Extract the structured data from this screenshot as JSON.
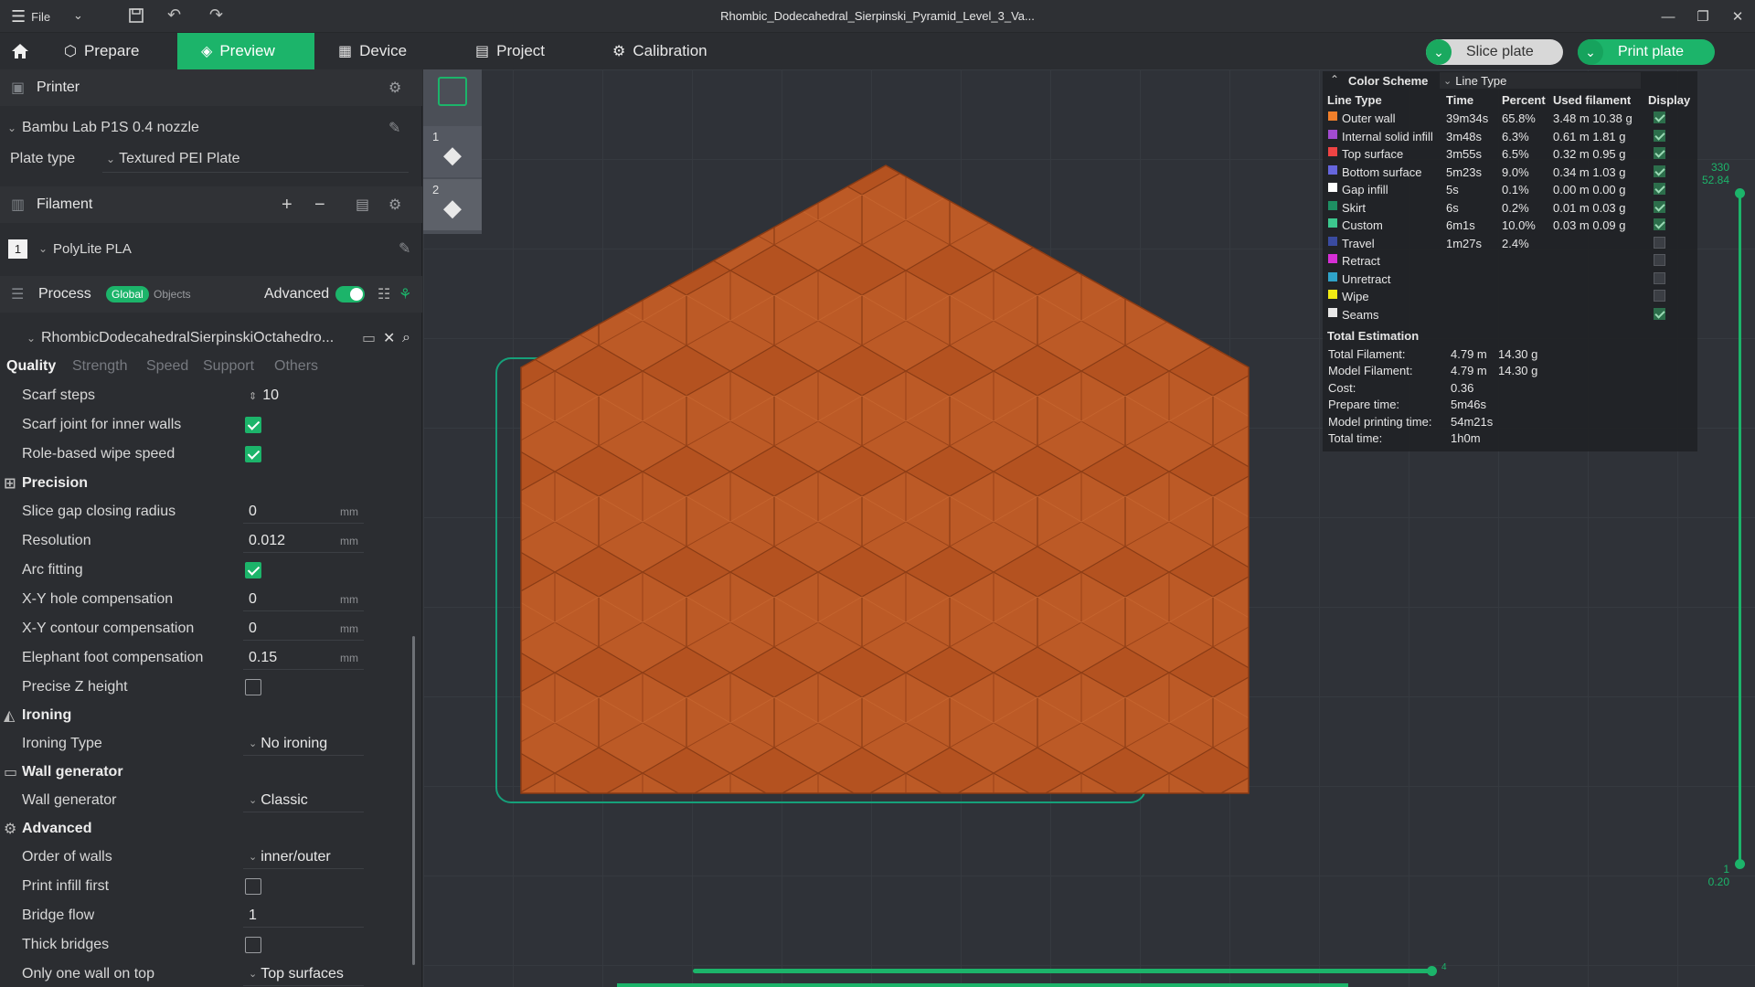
{
  "window": {
    "title": "Rhombic_Dodecahedral_Sierpinski_Pyramid_Level_3_Va...",
    "file_menu": "File"
  },
  "nav": {
    "tabs": [
      {
        "label": "Prepare"
      },
      {
        "label": "Preview"
      },
      {
        "label": "Device"
      },
      {
        "label": "Project"
      },
      {
        "label": "Calibration"
      }
    ],
    "slice_plate": "Slice plate",
    "print_plate": "Print plate"
  },
  "printer": {
    "section_label": "Printer",
    "name": "Bambu Lab P1S 0.4 nozzle",
    "plate_type_label": "Plate type",
    "plate_type_value": "Textured PEI Plate"
  },
  "filament": {
    "section_label": "Filament",
    "slot": "1",
    "name": "PolyLite PLA"
  },
  "process": {
    "section_label": "Process",
    "global": "Global",
    "objects": "Objects",
    "advanced_label": "Advanced",
    "object_name": "RhombicDodecahedralSierpinskiOctahedro...",
    "tabs": [
      "Quality",
      "Strength",
      "Speed",
      "Support",
      "Others"
    ]
  },
  "settings": {
    "scarf_steps": {
      "label": "Scarf steps",
      "value": "10"
    },
    "scarf_joint_inner": {
      "label": "Scarf joint for inner walls"
    },
    "role_wipe": {
      "label": "Role-based wipe speed"
    },
    "precision_group": "Precision",
    "slice_gap": {
      "label": "Slice gap closing radius",
      "value": "0",
      "unit": "mm"
    },
    "resolution": {
      "label": "Resolution",
      "value": "0.012",
      "unit": "mm"
    },
    "arc_fitting": {
      "label": "Arc fitting"
    },
    "xy_hole": {
      "label": "X-Y hole compensation",
      "value": "0",
      "unit": "mm"
    },
    "xy_contour": {
      "label": "X-Y contour compensation",
      "value": "0",
      "unit": "mm"
    },
    "elephant": {
      "label": "Elephant foot compensation",
      "value": "0.15",
      "unit": "mm"
    },
    "precise_z": {
      "label": "Precise Z height"
    },
    "ironing_group": "Ironing",
    "ironing_type": {
      "label": "Ironing Type",
      "value": "No ironing"
    },
    "wall_group": "Wall generator",
    "wall_generator": {
      "label": "Wall generator",
      "value": "Classic"
    },
    "advanced_group": "Advanced",
    "order_walls": {
      "label": "Order of walls",
      "value": "inner/outer"
    },
    "infill_first": {
      "label": "Print infill first"
    },
    "bridge_flow": {
      "label": "Bridge flow",
      "value": "1"
    },
    "thick_bridges": {
      "label": "Thick bridges"
    },
    "one_wall_top": {
      "label": "Only one wall on top",
      "value": "Top surfaces"
    }
  },
  "plates": [
    "1",
    "2"
  ],
  "legend": {
    "color_scheme_label": "Color Scheme",
    "scheme_value": "Line Type",
    "headers": [
      "Line Type",
      "Time",
      "Percent",
      "Used filament",
      "Display"
    ],
    "rows": [
      {
        "name": "Outer wall",
        "color": "#f2802b",
        "time": "39m34s",
        "percent": "65.8%",
        "used": "3.48 m  10.38 g",
        "display": true
      },
      {
        "name": "Internal solid infill",
        "color": "#a24bd0",
        "time": "3m48s",
        "percent": "6.3%",
        "used": "0.61 m  1.81 g",
        "display": true
      },
      {
        "name": "Top surface",
        "color": "#ef4444",
        "time": "3m55s",
        "percent": "6.5%",
        "used": "0.32 m  0.95 g",
        "display": true
      },
      {
        "name": "Bottom surface",
        "color": "#6666dd",
        "time": "5m23s",
        "percent": "9.0%",
        "used": "0.34 m  1.03 g",
        "display": true
      },
      {
        "name": "Gap infill",
        "color": "#ffffff",
        "time": "5s",
        "percent": "0.1%",
        "used": "0.00 m  0.00 g",
        "display": true
      },
      {
        "name": "Skirt",
        "color": "#1e8f63",
        "time": "6s",
        "percent": "0.2%",
        "used": "0.01 m  0.03 g",
        "display": true
      },
      {
        "name": "Custom",
        "color": "#3cc78e",
        "time": "6m1s",
        "percent": "10.0%",
        "used": "0.03 m  0.09 g",
        "display": true
      },
      {
        "name": "Travel",
        "color": "#3a4ba0",
        "time": "1m27s",
        "percent": "2.4%",
        "used": "",
        "display": false
      },
      {
        "name": "Retract",
        "color": "#d62fd6",
        "time": "",
        "percent": "",
        "used": "",
        "display": false
      },
      {
        "name": "Unretract",
        "color": "#2fa3c9",
        "time": "",
        "percent": "",
        "used": "",
        "display": false
      },
      {
        "name": "Wipe",
        "color": "#f1ea14",
        "time": "",
        "percent": "",
        "used": "",
        "display": false
      },
      {
        "name": "Seams",
        "color": "#e8e8e8",
        "time": "",
        "percent": "",
        "used": "",
        "display": true
      }
    ],
    "total_label": "Total Estimation",
    "totals": [
      {
        "label": "Total Filament:",
        "a": "4.79 m",
        "b": "14.30 g"
      },
      {
        "label": "Model Filament:",
        "a": "4.79 m",
        "b": "14.30 g"
      },
      {
        "label": "Cost:",
        "a": "0.36",
        "b": ""
      },
      {
        "label": "Prepare time:",
        "a": "5m46s",
        "b": ""
      },
      {
        "label": "Model printing time:",
        "a": "54m21s",
        "b": ""
      },
      {
        "label": "Total time:",
        "a": "1h0m",
        "b": ""
      }
    ]
  },
  "layer_slider": {
    "top_layer": "330",
    "top_height": "52.84",
    "bottom_layer": "1",
    "bottom_height": "0.20",
    "horizontal_pos": "4"
  }
}
